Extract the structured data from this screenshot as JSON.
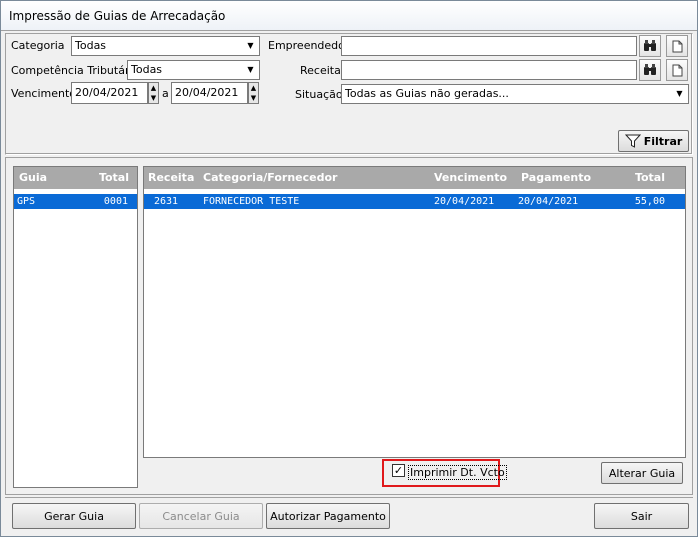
{
  "window": {
    "title": "Impressão de Guias de Arrecadação"
  },
  "filters": {
    "categoria_label": "Categoria",
    "categoria_value": "Todas",
    "competencia_label": "Competência Tributária",
    "competencia_value": "Todas",
    "vencimento_label": "Vencimento",
    "vencimento_from": "20/04/2021",
    "vencimento_sep": "a",
    "vencimento_to": "20/04/2021",
    "empreendedor_label": "Empreendedor",
    "empreendedor_value": "",
    "receita_label": "Receita",
    "receita_value": "",
    "situacao_label": "Situação",
    "situacao_value": "Todas as Guias não geradas...",
    "filtrar_button": "Filtrar"
  },
  "guias_list": {
    "headers": [
      "Guia",
      "Total"
    ],
    "rows": [
      {
        "guia": "GPS",
        "total": "0001"
      }
    ]
  },
  "receitas_list": {
    "headers": [
      "Receita",
      "Categoria/Fornecedor",
      "Vencimento",
      "Pagamento",
      "Total"
    ],
    "rows": [
      {
        "receita": "2631",
        "categoria": "FORNECEDOR TESTE",
        "vencimento": "20/04/2021",
        "pagamento": "20/04/2021",
        "total": "55,00"
      }
    ]
  },
  "options": {
    "imprimir_dt_vcto_label": "Imprimir Dt. Vcto",
    "imprimir_dt_vcto_checked": true,
    "alterar_guia_button": "Alterar Guia"
  },
  "actions": {
    "gerar_guia": "Gerar Guia",
    "cancelar_guia": "Cancelar Guia",
    "autorizar_pagamento": "Autorizar Pagamento",
    "sair": "Sair"
  },
  "colors": {
    "selection": "#0a6ad6",
    "list_header": "#a9a9a9",
    "highlight": "#e0191b"
  },
  "icons": [
    "binoculars-icon",
    "new-document-icon",
    "funnel-icon",
    "chevron-down-icon",
    "spin-up-icon",
    "spin-down-icon",
    "checkmark-icon"
  ]
}
